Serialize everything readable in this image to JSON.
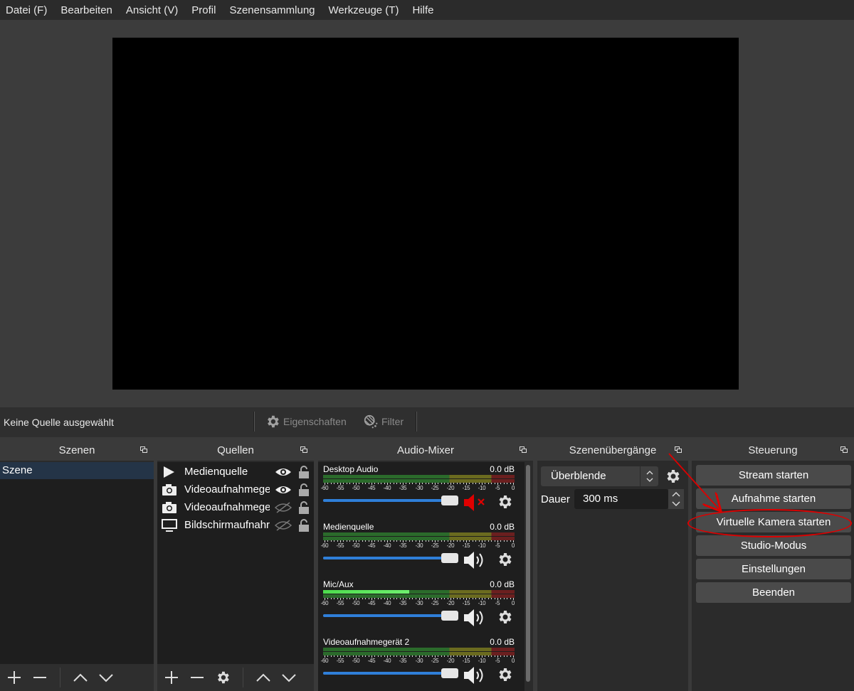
{
  "menu": [
    "Datei (F)",
    "Bearbeiten",
    "Ansicht (V)",
    "Profil",
    "Szenensammlung",
    "Werkzeuge (T)",
    "Hilfe"
  ],
  "source_bar": {
    "no_source": "Keine Quelle ausgewählt",
    "properties": "Eigenschaften",
    "filter": "Filter"
  },
  "scenes": {
    "title": "Szenen",
    "items": [
      "Szene"
    ]
  },
  "sources": {
    "title": "Quellen",
    "items": [
      {
        "name": "Medienquelle",
        "icon": "play-icon",
        "visible": true
      },
      {
        "name": "Videoaufnahmege",
        "icon": "camera-icon",
        "visible": true
      },
      {
        "name": "Videoaufnahmege",
        "icon": "camera-icon",
        "visible": false
      },
      {
        "name": "Bildschirmaufnahr",
        "icon": "monitor-icon",
        "visible": false
      }
    ]
  },
  "mixer": {
    "title": "Audio-Mixer",
    "scale_labels": [
      "-60",
      "-55",
      "-50",
      "-45",
      "-40",
      "-35",
      "-30",
      "-25",
      "-20",
      "-15",
      "-10",
      "-5",
      "0"
    ],
    "channels": [
      {
        "name": "Desktop Audio",
        "db": "0.0 dB",
        "muted": true,
        "level": 0.0,
        "volume": 1.0
      },
      {
        "name": "Medienquelle",
        "db": "0.0 dB",
        "muted": false,
        "level": 0.0,
        "volume": 1.0
      },
      {
        "name": "Mic/Aux",
        "db": "0.0 dB",
        "muted": false,
        "level": 0.45,
        "volume": 1.0
      },
      {
        "name": "Videoaufnahmegerät 2",
        "db": "0.0 dB",
        "muted": false,
        "level": 0.0,
        "volume": 1.0
      }
    ]
  },
  "transitions": {
    "title": "Szenenübergänge",
    "selected": "Überblende",
    "duration_label": "Dauer",
    "duration_value": "300 ms"
  },
  "controls": {
    "title": "Steuerung",
    "buttons": [
      "Stream starten",
      "Aufnahme starten",
      "Virtuelle Kamera starten",
      "Studio-Modus",
      "Einstellungen",
      "Beenden"
    ]
  },
  "colors": {
    "annotation": "#d00000",
    "selection": "#243447",
    "slider": "#2f7fd9"
  }
}
